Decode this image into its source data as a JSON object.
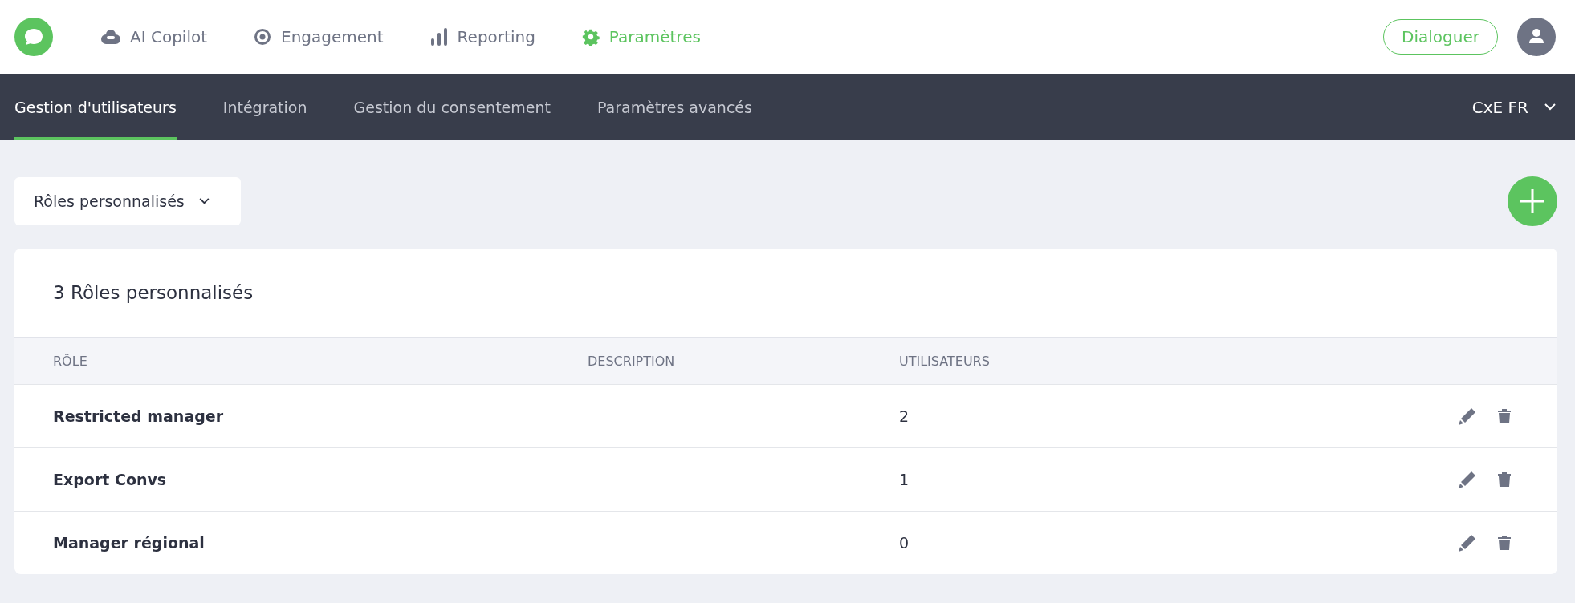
{
  "top_nav": {
    "items": [
      {
        "label": "AI Copilot",
        "kind": "cloud",
        "selected": false
      },
      {
        "label": "Engagement",
        "kind": "target",
        "selected": false
      },
      {
        "label": "Reporting",
        "kind": "bars",
        "selected": false
      },
      {
        "label": "Paramètres",
        "kind": "gear",
        "selected": true
      }
    ],
    "chat_button": "Dialoguer"
  },
  "sub_nav": {
    "tabs": [
      {
        "label": "Gestion d'utilisateurs",
        "selected": true
      },
      {
        "label": "Intégration",
        "selected": false
      },
      {
        "label": "Gestion du consentement",
        "selected": false
      },
      {
        "label": "Paramètres avancés",
        "selected": false
      }
    ],
    "workspace": "CxE FR"
  },
  "filter": {
    "value": "Rôles personnalisés"
  },
  "card": {
    "title": "3 Rôles personnalisés",
    "columns": [
      "RÔLE",
      "DESCRIPTION",
      "UTILISATEURS"
    ],
    "rows": [
      {
        "role": "Restricted manager",
        "users": "2"
      },
      {
        "role": "Export Convs",
        "users": "1"
      },
      {
        "role": "Manager régional",
        "users": "0"
      }
    ]
  }
}
